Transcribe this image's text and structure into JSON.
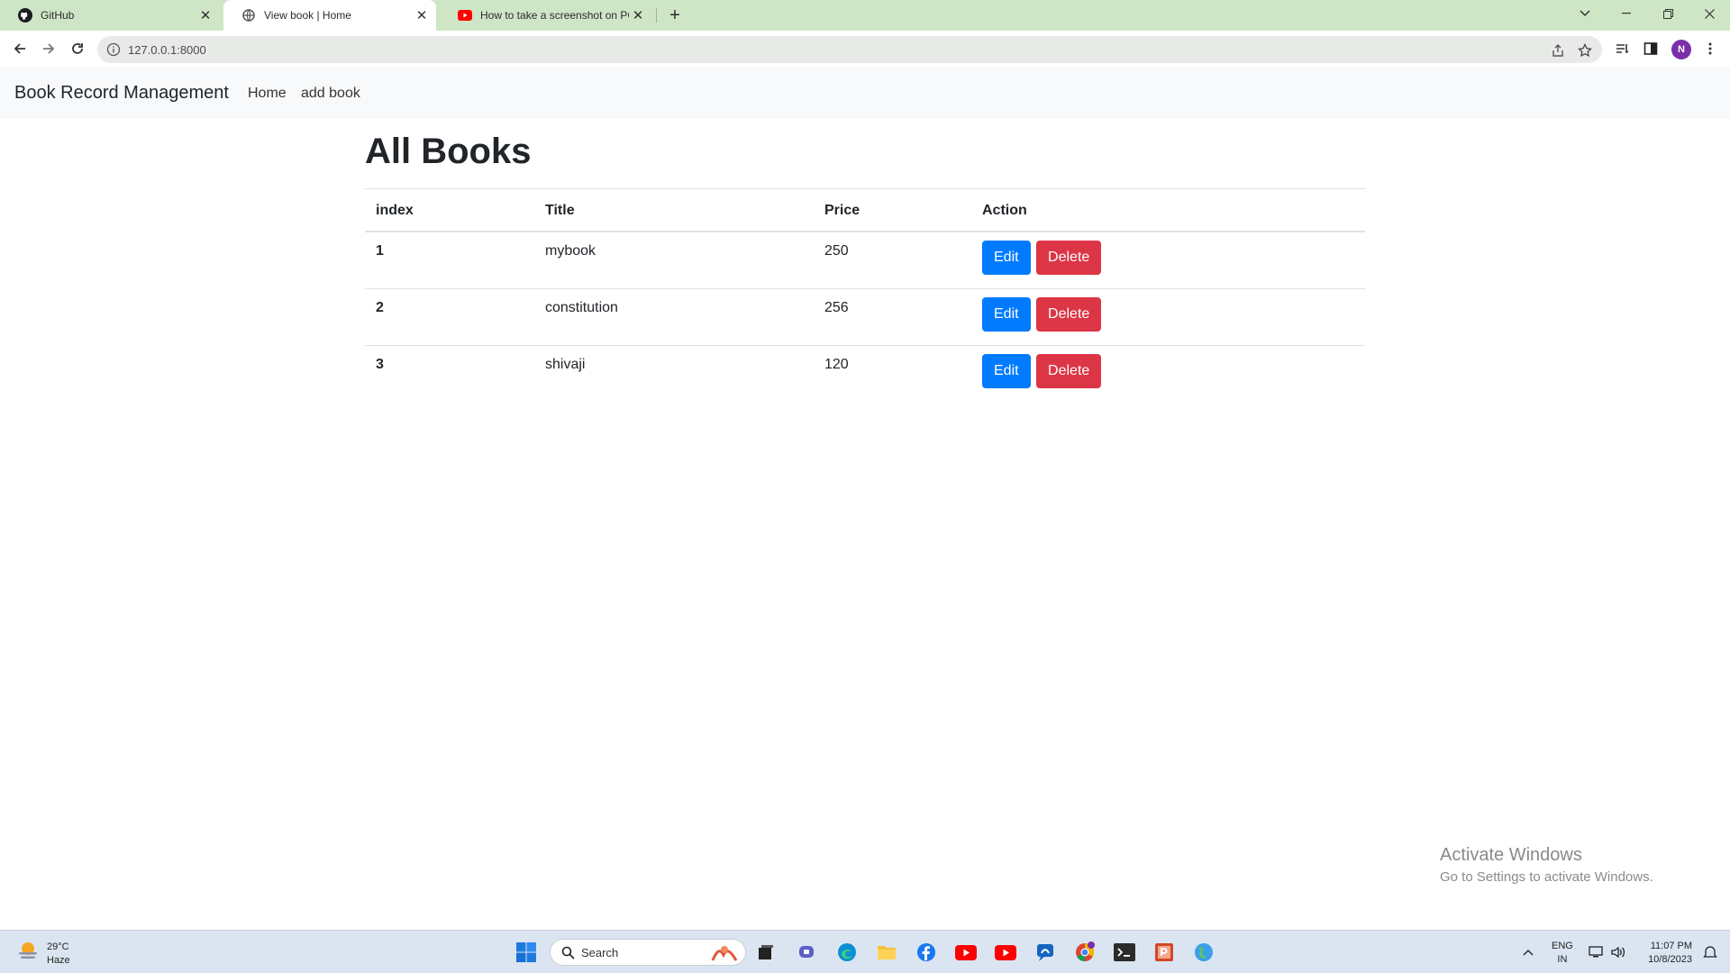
{
  "browser": {
    "tabs": [
      {
        "label": "GitHub",
        "icon": "github-icon",
        "active": false
      },
      {
        "label": "View book | Home",
        "icon": "globe-icon",
        "active": true
      },
      {
        "label": "How to take a screenshot on PC",
        "icon": "youtube-icon",
        "active": false
      }
    ],
    "url": "127.0.0.1:8000",
    "profile_initial": "N"
  },
  "navbar": {
    "brand": "Book Record Management",
    "links": [
      "Home",
      "add book"
    ]
  },
  "main": {
    "title": "All Books",
    "columns": [
      "index",
      "Title",
      "Price",
      "Action"
    ],
    "rows": [
      {
        "index": "1",
        "title": "mybook",
        "price": "250"
      },
      {
        "index": "2",
        "title": "constitution",
        "price": "256"
      },
      {
        "index": "3",
        "title": "shivaji",
        "price": "120"
      }
    ],
    "edit_label": "Edit",
    "delete_label": "Delete"
  },
  "watermark": {
    "line1": "Activate Windows",
    "line2": "Go to Settings to activate Windows."
  },
  "taskbar": {
    "weather_temp": "29°C",
    "weather_desc": "Haze",
    "search_placeholder": "Search",
    "lang_line1": "ENG",
    "lang_line2": "IN",
    "time": "11:07 PM",
    "date": "10/8/2023"
  },
  "colors": {
    "primary": "#007bff",
    "danger": "#dc3545",
    "tabbar": "#cfe6c6",
    "navbar_bg": "#f8f9fa"
  }
}
